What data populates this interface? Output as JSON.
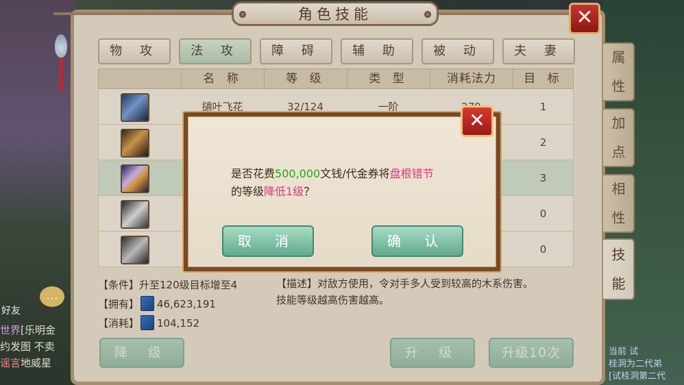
{
  "title": "角色技能",
  "category_tabs": [
    "物 攻",
    "法 攻",
    "障 碍",
    "辅 助",
    "被 动",
    "夫 妻"
  ],
  "active_category": "法 攻",
  "side_tabs": [
    "属 性",
    "加 点",
    "相 性",
    "技 能"
  ],
  "active_side_tab": "技 能",
  "table": {
    "headers": [
      "",
      "名 称",
      "等 级",
      "类 型",
      "消耗法力",
      "目 标"
    ],
    "rows": [
      {
        "name": "擿叶飞花",
        "level": "32/124",
        "type": "一阶",
        "mana": "279",
        "target": "1"
      },
      {
        "name": "",
        "level": "",
        "type": "",
        "mana": "",
        "target": "2"
      },
      {
        "name": "",
        "level": "",
        "type": "",
        "mana": "",
        "target": "3"
      },
      {
        "name": "",
        "level": "",
        "type": "",
        "mana": "",
        "target": "0"
      },
      {
        "name": "",
        "level": "",
        "type": "",
        "mana": "",
        "target": "0"
      }
    ]
  },
  "info": {
    "condition": "【条件】升至120级目标增至4",
    "owned_label": "【拥有】",
    "owned_value": "46,623,191",
    "cost_label": "【消耗】",
    "cost_value": "104,152",
    "desc_line1": "【描述】对敌方使用，令对手多人受到较高的木系伤害。",
    "desc_line2": "技能等级越高伤害越高。"
  },
  "buttons": {
    "downgrade": "降 级",
    "upgrade": "升 级",
    "upgrade10": "升级10次"
  },
  "dialog": {
    "msg_prefix": "是否花费",
    "amount": "500,000",
    "msg_mid": "文钱/代金券将",
    "skill": "盘根错节",
    "msg_line2_prefix": "的等级",
    "action": "降低1级",
    "msg_suffix": "？",
    "cancel": "取 消",
    "confirm": "确 认"
  },
  "background": {
    "friend": "好友",
    "chat_tag_world": "世界",
    "chat_line1": "[乐明金",
    "chat_line2": "约发图 不卖",
    "chat_tag_rumor": "谣言",
    "chat_line3": "地威星",
    "right_line1": "当前 试",
    "right_line2": "桂洞为二代弟",
    "right_line3": "[试桂洞第二代"
  },
  "colors": {
    "accent_green": "#27a51a",
    "accent_pink": "#e0357a",
    "close_red": "#c0302a"
  }
}
